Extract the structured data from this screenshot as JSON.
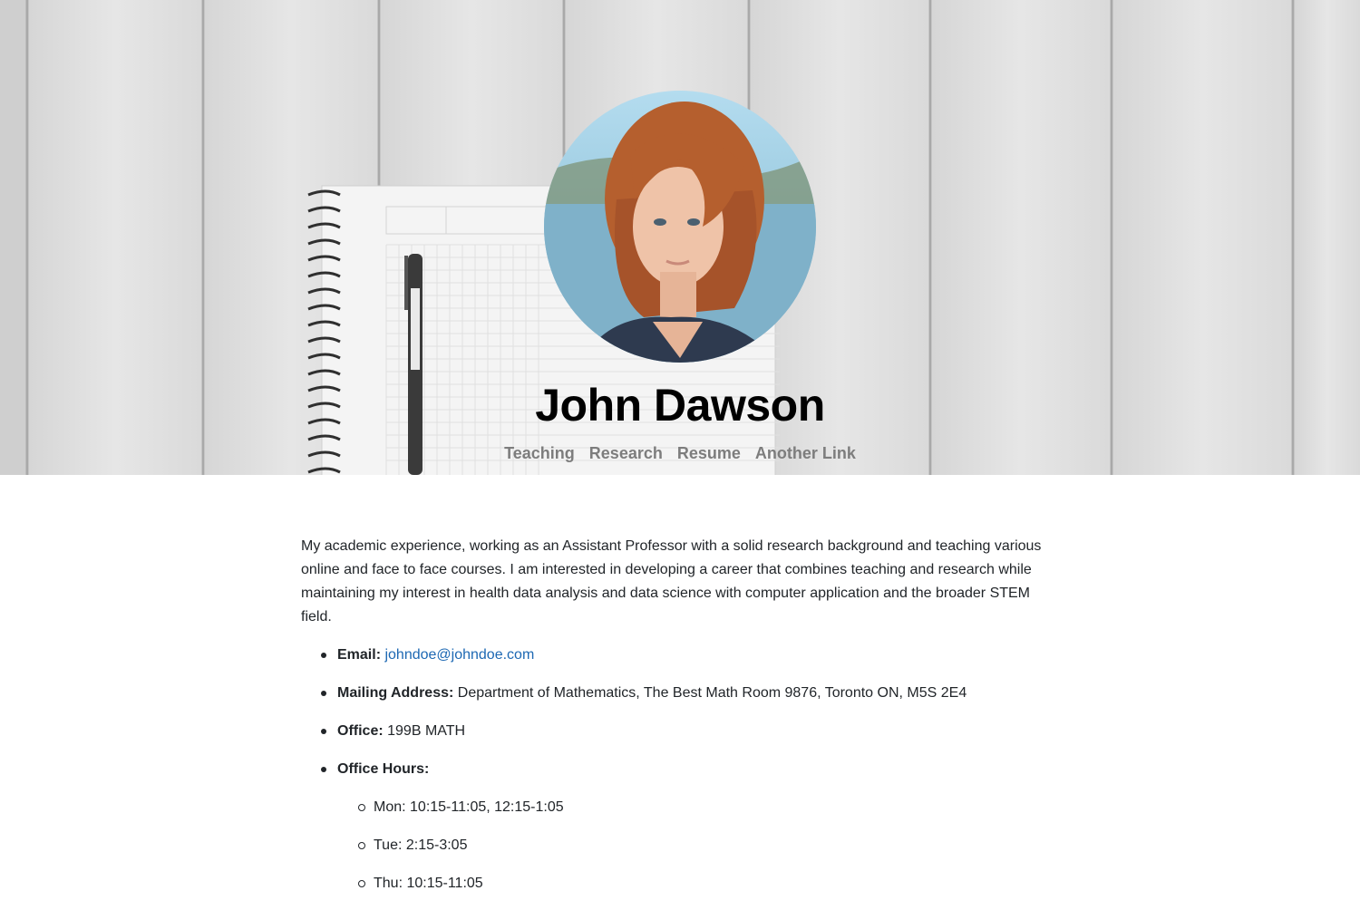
{
  "profile": {
    "name": "John Dawson"
  },
  "nav": {
    "links": [
      "Teaching",
      "Research",
      "Resume",
      "Another Link"
    ]
  },
  "about": {
    "intro": "My academic experience, working as an Assistant Professor with a solid research background and teaching various online and face to face courses. I am interested in developing a career that combines teaching and research while maintaining my interest in health data analysis and data science with computer application and the broader STEM field."
  },
  "contact": {
    "email_label": "Email:",
    "email_value": "johndoe@johndoe.com",
    "address_label": "Mailing Address:",
    "address_value": "Department of Mathematics, The Best Math Room 9876, Toronto ON, M5S 2E4",
    "office_label": "Office:",
    "office_value": "199B MATH",
    "hours_label": "Office Hours:",
    "hours": [
      "Mon: 10:15-11:05, 12:15-1:05",
      "Tue: 2:15-3:05",
      "Thu: 10:15-11:05"
    ]
  },
  "colors": {
    "link": "#1d68b3",
    "nav_link": "#7d7d7d",
    "text": "#212529"
  }
}
